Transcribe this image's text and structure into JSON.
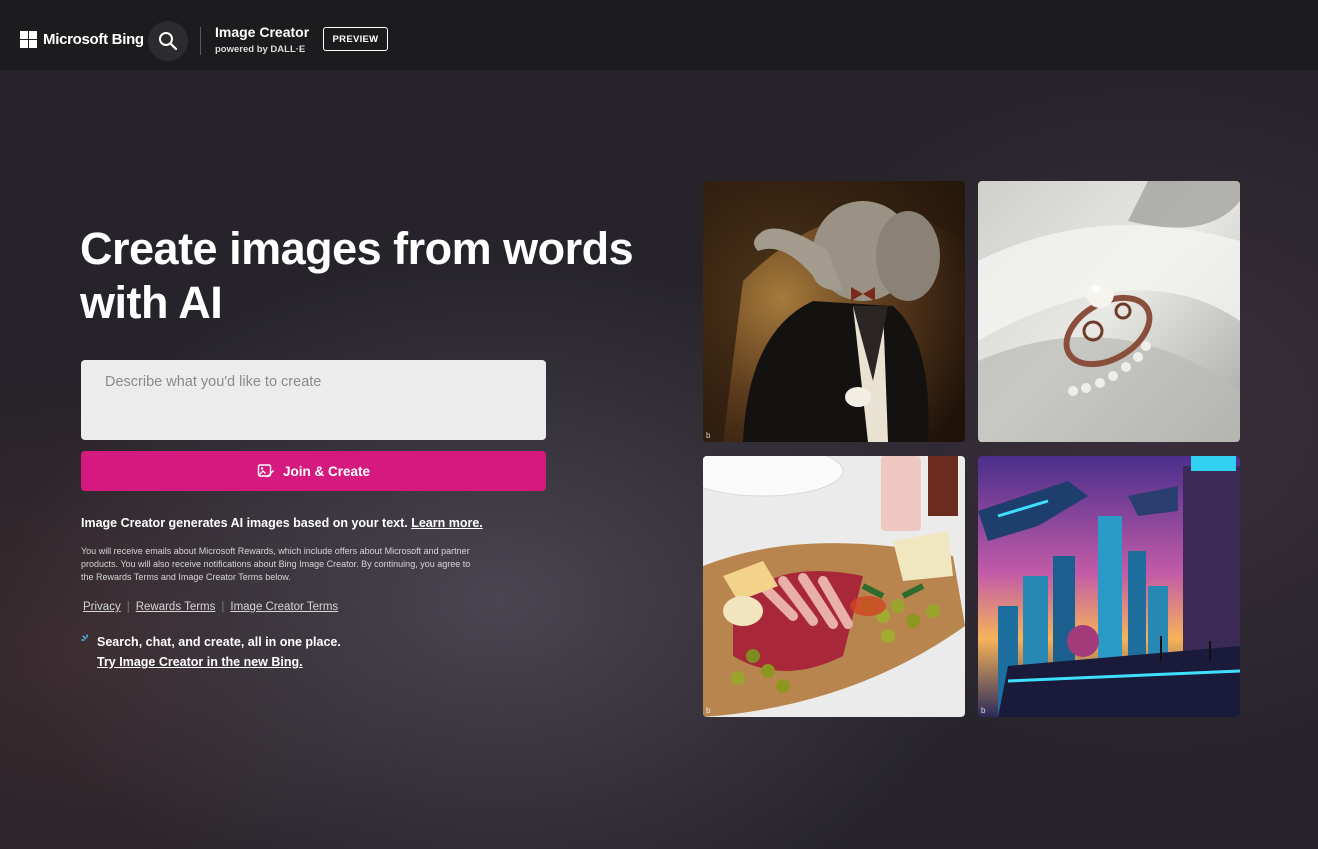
{
  "header": {
    "brand": "Microsoft Bing",
    "product_title": "Image Creator",
    "product_subtitle": "powered by DALL·E",
    "preview_badge": "PREVIEW"
  },
  "hero": {
    "title": "Create images from words with AI",
    "prompt_placeholder": "Describe what you'd like to create",
    "prompt_value": "",
    "create_button": "Join & Create"
  },
  "info": {
    "text": "Image Creator generates AI images based on your text.",
    "learn_more": "Learn more.",
    "disclaimer": "You will receive emails about Microsoft Rewards, which include offers about Microsoft and partner products. You will also receive notifications about Bing Image Creator. By continuing, you agree to the Rewards Terms and Image Creator Terms below."
  },
  "footer_links": [
    "Privacy",
    "Rewards Terms",
    "Image Creator Terms"
  ],
  "promo": {
    "line1": "Search, chat, and create, all in one place.",
    "link": "Try Image Creator in the new Bing."
  },
  "gallery": [
    {
      "subject": "elephant in a tuxedo with bow tie"
    },
    {
      "subject": "pearl ring on white fabric"
    },
    {
      "subject": "charcuterie board with salami, cheese and olives"
    },
    {
      "subject": "futuristic city with flying ships"
    }
  ],
  "colors": {
    "accent": "#d6197f",
    "topbar": "#1c1c1e",
    "background": "#26232a"
  },
  "icons": {
    "search": "search-icon",
    "create": "create-image-icon",
    "promo": "sparkle-icon"
  }
}
